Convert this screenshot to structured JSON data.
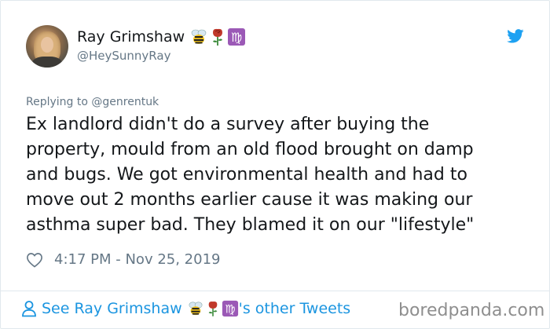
{
  "tweet": {
    "author_name": "Ray Grimshaw",
    "author_emojis": [
      "bee-emoji",
      "rose-emoji",
      "virgo-emoji"
    ],
    "handle": "@HeySunnyRay",
    "replying_to_prefix": "Replying to ",
    "replying_to_handle": "@genrentuk",
    "text": "Ex landlord didn't do a survey after buying the\nproperty, mould from an old flood brought on damp\nand bugs. We got environmental health and had to\nmove out 2 months earlier cause it was making our\nasthma super bad. They blamed it on our \"lifestyle\"",
    "timestamp": "4:17 PM - Nov 25, 2019"
  },
  "footer": {
    "see_prefix": "See Ray Grimshaw",
    "see_suffix": "'s other Tweets",
    "watermark": "boredpanda.com"
  },
  "icons": {
    "bird": "twitter-bird-icon",
    "heart": "heart-outline-icon",
    "person": "person-icon"
  },
  "colors": {
    "twitter_blue": "#1da1f2",
    "link_blue": "#1b95e0",
    "text": "#14171a",
    "muted": "#657786",
    "virgo_purple": "#9b59b6",
    "rose_red": "#c0392b"
  }
}
